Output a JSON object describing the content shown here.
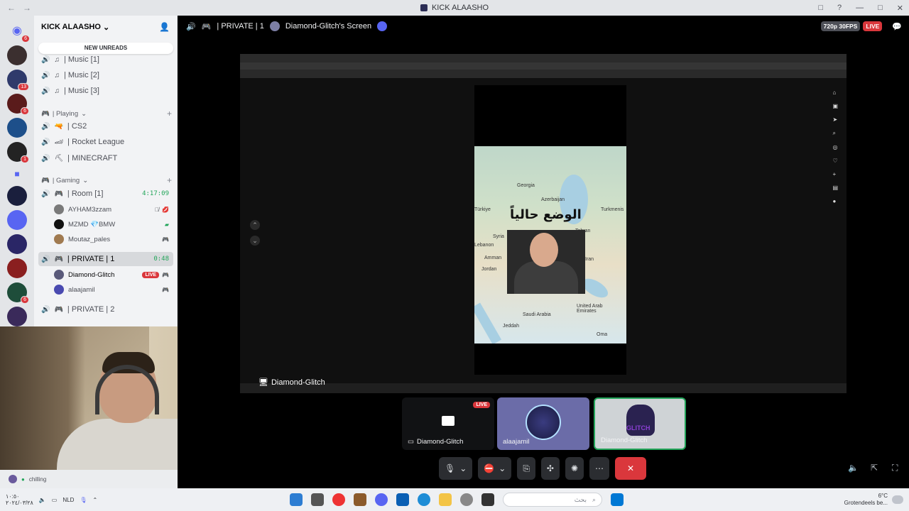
{
  "window": {
    "title": "KICK ALAASHO",
    "nav_back": "←",
    "nav_forward": "→",
    "controls": [
      "□",
      "?",
      "—",
      "□",
      "✕"
    ]
  },
  "server_rail": {
    "badges": [
      "6",
      "13",
      "6",
      "1",
      "6",
      "1"
    ]
  },
  "sidebar": {
    "server_name": "KICK ALAASHO",
    "new_unreads": "NEW UNREADS",
    "music_channels": [
      "| Music [1]",
      "| Music [2]",
      "| Music [3]"
    ],
    "cat_playing": "| Playing",
    "playing_channels": [
      "| CS2",
      "| Rocket League",
      "| MINECRAFT"
    ],
    "cat_gaming": "| Gaming",
    "room1": {
      "label": "| Room [1]",
      "timer": "4:17:09"
    },
    "room1_users": [
      "AYHAM3zzam",
      "MZMD 💎BMW",
      "Moutaz_pales"
    ],
    "private1": {
      "label": "| PRIVATE | 1",
      "timer": "0:48"
    },
    "private1_users": [
      "Diamond-Glitch",
      "alaajamil"
    ],
    "live_badge": "LIVE",
    "private2": "| PRIVATE | 2"
  },
  "user_panel": {
    "status": "chilling"
  },
  "stage": {
    "channel": "| PRIVATE | 1",
    "stream_title": "Diamond-Glitch's Screen",
    "quality": "720p 30FPS",
    "live": "LIVE"
  },
  "screen": {
    "map_title": "الوضع حالياً",
    "labels": {
      "georgia": "Georgia",
      "azerbaijan": "Azerbaijan",
      "turkiye": "Türkiye",
      "turkmenistan": "Turkmenis",
      "tehran": "Tehran",
      "syria": "Syria",
      "lebanon": "Lebanon",
      "amman": "Amman",
      "jordan": "Jordan",
      "iran": "Iran",
      "saudi": "Saudi Arabia",
      "uae": "United Arab Emirates",
      "jeddah": "Jeddah",
      "oman": "Oma"
    },
    "streamer_name": "Diamond-Glitch"
  },
  "tiles": [
    {
      "name": "Diamond-Glitch",
      "live": "LIVE"
    },
    {
      "name": "alaajamil"
    },
    {
      "name": "Diamond-Glitch",
      "logo": "GLITCH"
    }
  ],
  "taskbar": {
    "time": "١٠:٥٠",
    "date": "٢٠٢٤/٠٣/٢٨",
    "lang": "NLD",
    "search_placeholder": "بحث",
    "temp": "6°C",
    "weather": "Grotendeels be..."
  }
}
